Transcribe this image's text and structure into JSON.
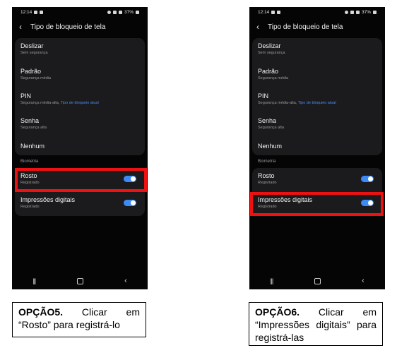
{
  "phones": [
    {
      "status": {
        "time": "12:14",
        "battery": "37%"
      },
      "title": "Tipo de bloqueio de tela",
      "lock_types": [
        {
          "title": "Deslizar",
          "subtitle": "Sem segurança"
        },
        {
          "title": "Padrão",
          "subtitle": "Segurança média"
        },
        {
          "title": "PIN",
          "subtitle": "Segurança média-alta, ",
          "accent": "Tipo de bloqueio atual"
        },
        {
          "title": "Senha",
          "subtitle": "Segurança alta"
        },
        {
          "title": "Nenhum"
        }
      ],
      "biometrics_label": "Biometria",
      "biometrics": [
        {
          "title": "Rosto",
          "subtitle": "Registrado",
          "enabled": true
        },
        {
          "title": "Impressões digitais",
          "subtitle": "Registrado",
          "enabled": true
        }
      ]
    },
    {
      "status": {
        "time": "12:14",
        "battery": "37%"
      },
      "title": "Tipo de bloqueio de tela",
      "lock_types": [
        {
          "title": "Deslizar",
          "subtitle": "Sem segurança"
        },
        {
          "title": "Padrão",
          "subtitle": "Segurança média"
        },
        {
          "title": "PIN",
          "subtitle": "Segurança média-alta, ",
          "accent": "Tipo de bloqueio atual"
        },
        {
          "title": "Senha",
          "subtitle": "Segurança alta"
        },
        {
          "title": "Nenhum"
        }
      ],
      "biometrics_label": "Biometria",
      "biometrics": [
        {
          "title": "Rosto",
          "subtitle": "Registrado",
          "enabled": true
        },
        {
          "title": "Impressões digitais",
          "subtitle": "Registrado",
          "enabled": true
        }
      ]
    }
  ],
  "captions": [
    {
      "bold": "OPÇÃO5.",
      "text": " Clicar em “Rosto” para registrá-lo"
    },
    {
      "bold": "OPÇÃO6.",
      "text": " Clicar em “Impressões digitais” para registrá-las"
    }
  ],
  "colors": {
    "accent": "#4a8df8",
    "highlight": "#ee1111",
    "screen": "#050505",
    "card": "#1b1b1d"
  },
  "icons": {
    "back": "chevron-left-icon",
    "nav_recent": "recent-apps-icon",
    "nav_home": "home-icon",
    "nav_back": "back-nav-icon"
  }
}
